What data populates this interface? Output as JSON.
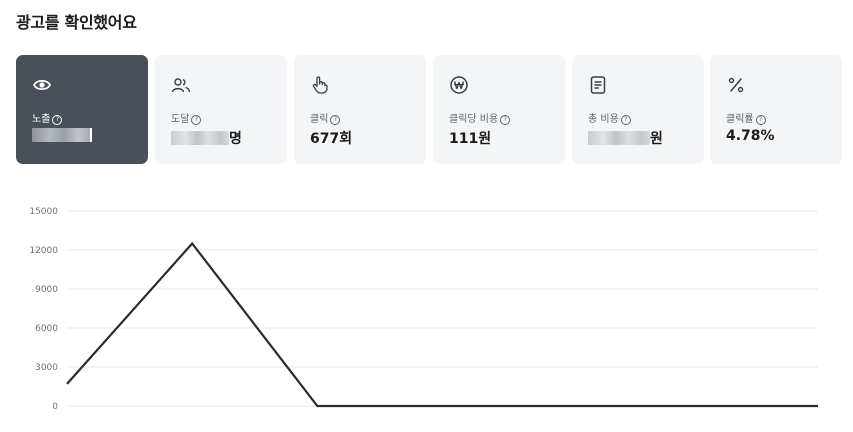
{
  "page": {
    "title": "광고를 확인했어요"
  },
  "metrics": [
    {
      "label": "노출",
      "value": "",
      "icon": "eye-icon",
      "active": true
    },
    {
      "label": "도달",
      "value": "명",
      "icon": "people-icon",
      "active": false
    },
    {
      "label": "클릭",
      "value": "677회",
      "icon": "hand-pointer-icon",
      "active": false
    },
    {
      "label": "클릭당 비용",
      "value": "111원",
      "icon": "won-coin-icon",
      "active": false
    },
    {
      "label": "총 비용",
      "value": "원",
      "icon": "receipt-icon",
      "active": false
    },
    {
      "label": "클릭률",
      "value": "4.78%",
      "icon": "percent-icon",
      "active": false
    }
  ],
  "colors": {
    "active_card": "#4a5059",
    "card": "#f4f5f6",
    "line": "#2b2b2b"
  },
  "chart_data": {
    "type": "line",
    "title": "",
    "xlabel": "",
    "ylabel": "",
    "ylim": [
      0,
      15000
    ],
    "yticks": [
      "15000",
      "12000",
      "9000",
      "6000",
      "3000",
      "0"
    ],
    "grid": true,
    "series": [
      {
        "values": [
          1700,
          12500,
          0,
          0,
          0,
          0,
          0
        ]
      }
    ]
  }
}
